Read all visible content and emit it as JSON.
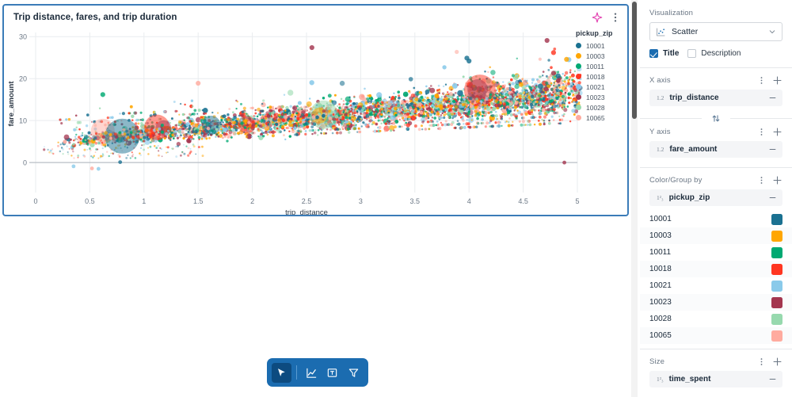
{
  "chart_card": {
    "title": "Trip distance, fares, and trip duration",
    "ai_icon": "sparkle-icon",
    "menu_icon": "kebab-menu-icon"
  },
  "chart_data": {
    "type": "scatter",
    "title": "Trip distance, fares, and trip duration",
    "xlabel": "trip_distance",
    "ylabel": "fare_amount",
    "xlim": [
      0,
      5
    ],
    "ylim": [
      -3,
      31
    ],
    "xticks": [
      "0",
      "0.5",
      "1",
      "1.5",
      "2",
      "2.5",
      "3",
      "3.5",
      "4",
      "4.5",
      "5"
    ],
    "xtick_values": [
      0,
      0.5,
      1,
      1.5,
      2,
      2.5,
      3,
      3.5,
      4,
      4.5,
      5
    ],
    "yticks": [
      "0",
      "10",
      "20",
      "30"
    ],
    "ytick_values": [
      0,
      10,
      20,
      30
    ],
    "grid": true,
    "size_encoding": "time_spent",
    "color_encoding": "pickup_zip",
    "legend": {
      "title": "pickup_zip",
      "position": "right",
      "entries": [
        {
          "label": "10001",
          "color": "#1a7191"
        },
        {
          "label": "10003",
          "color": "#ffa600"
        },
        {
          "label": "10011",
          "color": "#00a972"
        },
        {
          "label": "10018",
          "color": "#ff3621"
        },
        {
          "label": "10021",
          "color": "#8acaea"
        },
        {
          "label": "10023",
          "color": "#a4364f"
        },
        {
          "label": "10028",
          "color": "#97d9ae"
        },
        {
          "label": "10065",
          "color": "#ffab9f"
        }
      ]
    },
    "note": "Dense bubble scatter: fare_amount rises with trip_distance; bubble area encodes time_spent; color encodes pickup_zip."
  },
  "toolbar": {
    "buttons": [
      {
        "name": "select-tool",
        "icon": "cursor-icon",
        "active": true
      },
      {
        "name": "chart-tool",
        "icon": "line-chart-icon",
        "active": false
      },
      {
        "name": "text-tool",
        "icon": "text-box-icon",
        "active": false
      },
      {
        "name": "filter-tool",
        "icon": "filter-icon",
        "active": false
      }
    ]
  },
  "panel": {
    "visualization": {
      "label": "Visualization",
      "selected": "Scatter",
      "icon": "scatter-chart-icon"
    },
    "checkboxes": [
      {
        "label": "Title",
        "checked": true
      },
      {
        "label": "Description",
        "checked": false
      }
    ],
    "sections": [
      {
        "label": "X axis",
        "field": {
          "name": "trip_distance",
          "badge": "1.2",
          "type": "numeric"
        }
      },
      {
        "label": "Y axis",
        "field": {
          "name": "fare_amount",
          "badge": "1.2",
          "type": "numeric"
        }
      },
      {
        "label": "Color/Group by",
        "field": {
          "name": "pickup_zip",
          "badge": "1²₃",
          "type": "categorical"
        }
      },
      {
        "label": "Size",
        "field": {
          "name": "time_spent",
          "badge": "1²₃",
          "type": "categorical"
        }
      }
    ],
    "color_values": [
      {
        "label": "10001",
        "color": "#1a7191"
      },
      {
        "label": "10003",
        "color": "#ffa600"
      },
      {
        "label": "10011",
        "color": "#00a972"
      },
      {
        "label": "10018",
        "color": "#ff3621"
      },
      {
        "label": "10021",
        "color": "#8acaea"
      },
      {
        "label": "10023",
        "color": "#a4364f"
      },
      {
        "label": "10028",
        "color": "#97d9ae"
      },
      {
        "label": "10065",
        "color": "#ffab9f"
      }
    ]
  },
  "theme": {
    "accent": "#1b6cb0",
    "selection_border": "#3b7cb8",
    "panel_bg": "#ffffff",
    "chip_bg": "#f4f5f7"
  }
}
